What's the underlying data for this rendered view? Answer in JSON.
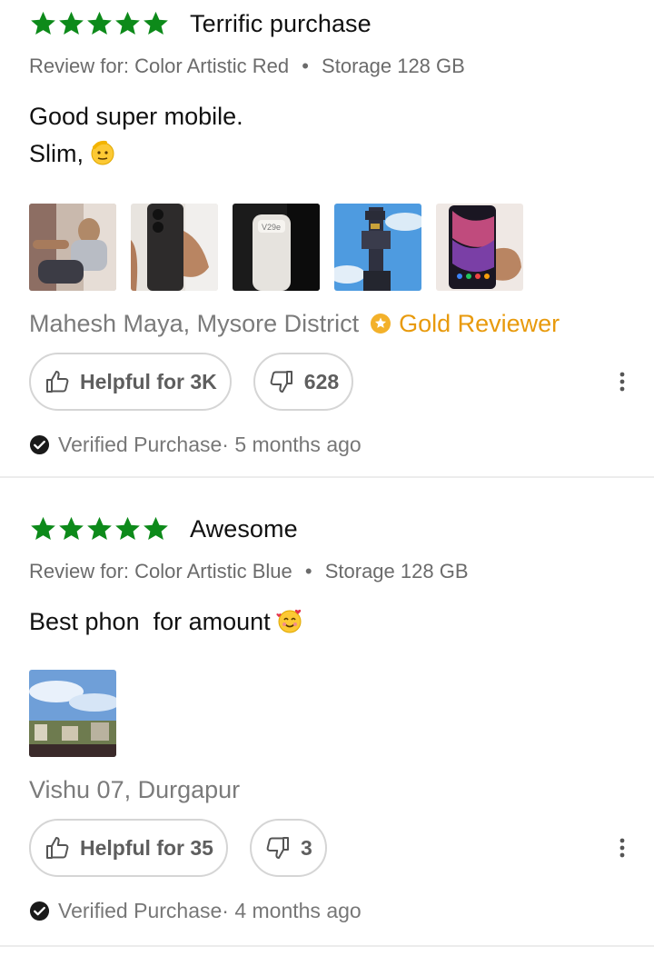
{
  "colors": {
    "star": "#0d8a1a",
    "gold": "#e89a0c",
    "muted": "#7b7b7b",
    "pill_border": "#d5d5d5"
  },
  "reviews": [
    {
      "rating": 5,
      "title": "Terrific purchase",
      "variant_prefix": "Review for: Color Artistic Red",
      "variant_sep": "•",
      "variant_storage": "Storage 128 GB",
      "body_line1": "Good super mobile.",
      "body_line2": "Slim,",
      "body_emoji": "saluting-face-emoji",
      "images": [
        "photo-person-sitting",
        "photo-phone-back",
        "photo-phone-box",
        "photo-statue-sky",
        "photo-phone-front"
      ],
      "author": "Mahesh Maya, Mysore District",
      "badge": "Gold Reviewer",
      "helpful_label": "Helpful for 3K",
      "unhelpful_count": "628",
      "verified": "Verified Purchase· 5 months ago"
    },
    {
      "rating": 5,
      "title": "Awesome",
      "variant_prefix": "Review for: Color Artistic Blue",
      "variant_sep": "•",
      "variant_storage": "Storage 128 GB",
      "body_line1": "Best phon  for amount",
      "body_emoji": "smiling-face-with-hearts-emoji",
      "images": [
        "photo-city-sky"
      ],
      "author": "Vishu 07, Durgapur",
      "helpful_label": "Helpful for 35",
      "unhelpful_count": "3",
      "verified": "Verified Purchase· 4 months ago"
    }
  ]
}
